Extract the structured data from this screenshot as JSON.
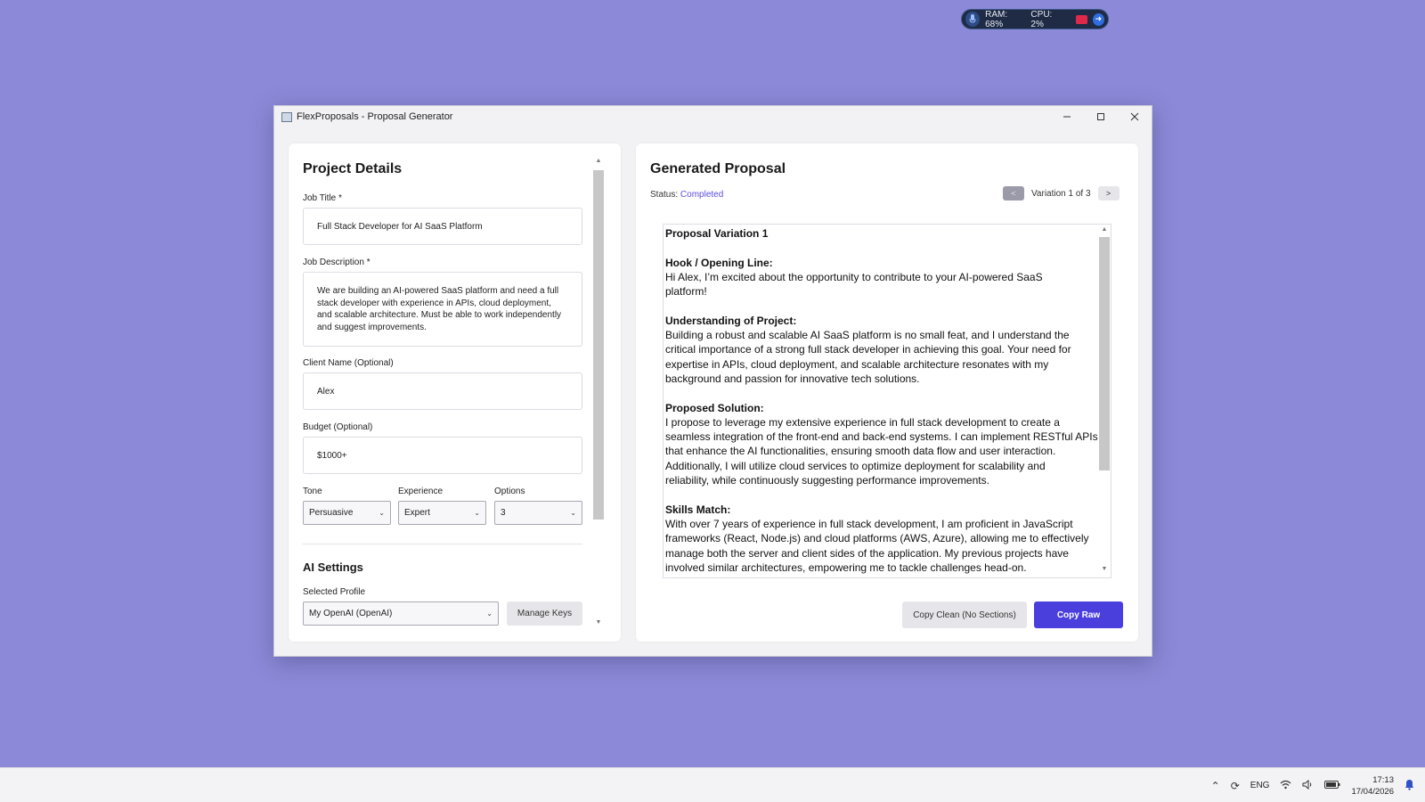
{
  "monitor": {
    "ram": "RAM: 68%",
    "cpu": "CPU: 2%"
  },
  "window": {
    "title": "FlexProposals - Proposal Generator"
  },
  "project": {
    "heading": "Project Details",
    "job_title_label": "Job Title *",
    "job_title_value": "Full Stack Developer for AI SaaS Platform",
    "job_description_label": "Job Description *",
    "job_description_value": "We are building an AI-powered SaaS platform and need a full stack developer with experience in APIs, cloud deployment, and scalable architecture. Must be able to work independently and suggest improvements.",
    "client_name_label": "Client Name (Optional)",
    "client_name_value": "Alex",
    "budget_label": "Budget (Optional)",
    "budget_value": "$1000+",
    "tone_label": "Tone",
    "tone_value": "Persuasive",
    "experience_label": "Experience",
    "experience_value": "Expert",
    "options_label": "Options",
    "options_value": "3"
  },
  "ai_settings": {
    "heading": "AI Settings",
    "profile_label": "Selected Profile",
    "profile_value": "My OpenAI (OpenAI)",
    "manage_keys_label": "Manage Keys"
  },
  "proposal": {
    "heading": "Generated Proposal",
    "status_label": "Status:",
    "status_value": "Completed",
    "prev_label": "<",
    "next_label": ">",
    "variation_text": "Variation 1 of 3",
    "title": "Proposal Variation 1",
    "hook_heading": "Hook / Opening Line:",
    "hook_lines": [
      "Hi Alex, I’m excited about the opportunity to contribute to your AI-powered SaaS",
      "platform!"
    ],
    "understanding_heading": "Understanding of Project:",
    "understanding_lines": [
      "Building a robust and scalable AI SaaS platform is no small feat, and I understand the",
      "critical importance of a strong full stack developer in achieving this goal. Your need for",
      "expertise in APIs, cloud deployment, and scalable architecture resonates with my",
      "background and passion for innovative tech solutions."
    ],
    "solution_heading": "Proposed Solution:",
    "solution_lines": [
      "I propose to leverage my extensive experience in full stack development to create a",
      "seamless integration of the front-end and back-end systems. I can implement RESTful APIs",
      "that enhance the AI functionalities, ensuring smooth data flow and user interaction.",
      "Additionally, I will utilize cloud services to optimize deployment for scalability and",
      "reliability, while continuously suggesting performance improvements."
    ],
    "skills_heading": "Skills Match:",
    "skills_lines": [
      "With over 7 years of experience in full stack development, I am proficient in JavaScript",
      "frameworks (React, Node.js) and cloud platforms (AWS, Azure), allowing me to effectively",
      "manage both the server and client sides of the application. My previous projects have",
      "involved similar architectures, empowering me to tackle challenges head-on."
    ],
    "copy_clean_label": "Copy Clean (No Sections)",
    "copy_raw_label": "Copy Raw"
  },
  "taskbar": {
    "language": "ENG",
    "time": "17:13",
    "date": "17/04/2026"
  }
}
